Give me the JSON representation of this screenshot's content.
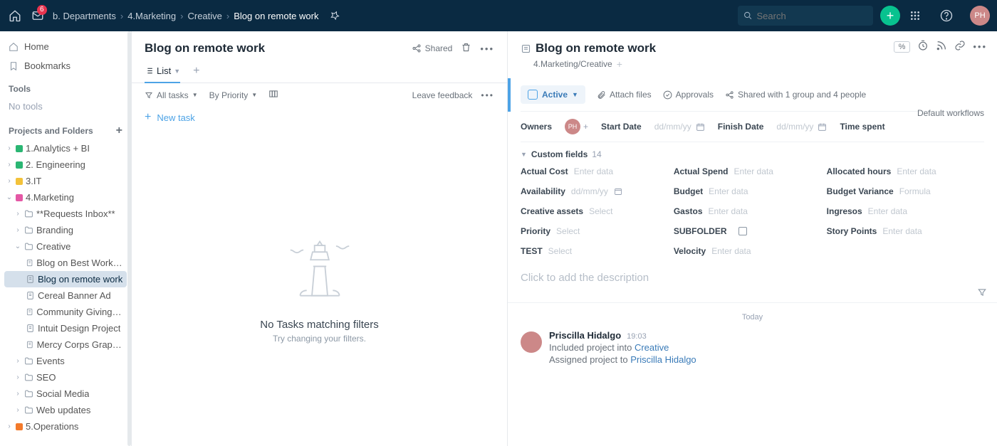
{
  "topbar": {
    "inbox_count": "6",
    "breadcrumbs": [
      "b. Departments",
      "4.Marketing",
      "Creative",
      "Blog on remote work"
    ],
    "search_placeholder": "Search"
  },
  "sidebar": {
    "home": "Home",
    "bookmarks": "Bookmarks",
    "tools_header": "Tools",
    "no_tools": "No tools",
    "projects_header": "Projects and Folders",
    "folders": [
      {
        "name": "1.Analytics + BI",
        "color": "#2bb673"
      },
      {
        "name": "2. Engineering",
        "color": "#2bb673"
      },
      {
        "name": "3.IT",
        "color": "#f3c23a"
      },
      {
        "name": "4.Marketing",
        "color": "#e458a5"
      },
      {
        "name": "5.Operations",
        "color": "#f37a2b"
      }
    ],
    "marketing_children": [
      "**Requests Inbox**",
      "Branding",
      "Creative",
      "Events",
      "SEO",
      "Social Media",
      "Web updates"
    ],
    "creative_children": [
      "Blog on Best Workplac...",
      "Blog on remote work",
      "Cereal Banner Ad",
      "Community Giving Cre...",
      "Intuit Design Project",
      "Mercy Corps Graphic ..."
    ]
  },
  "center": {
    "title": "Blog on remote work",
    "shared_label": "Shared",
    "list_tab": "List",
    "all_tasks": "All tasks",
    "by_priority": "By Priority",
    "leave_feedback": "Leave feedback",
    "new_task": "New task",
    "empty_title": "No Tasks matching filters",
    "empty_sub": "Try changing your filters."
  },
  "detail": {
    "title": "Blog on remote work",
    "location": "4.Marketing/Creative",
    "status_label": "Active",
    "attach_label": "Attach files",
    "approvals_label": "Approvals",
    "shared_text": "Shared with 1 group and 4 people",
    "default_workflows": "Default workflows",
    "owners_label": "Owners",
    "start_label": "Start Date",
    "finish_label": "Finish Date",
    "date_ph": "dd/mm/yy",
    "timespent_label": "Time spent",
    "custom_header": "Custom fields",
    "custom_count": "14",
    "fields": [
      {
        "name": "Actual Cost",
        "ph": "Enter data"
      },
      {
        "name": "Actual Spend",
        "ph": "Enter data"
      },
      {
        "name": "Allocated hours",
        "ph": "Enter data"
      },
      {
        "name": "Availability",
        "ph": "dd/mm/yy",
        "date": true
      },
      {
        "name": "Budget",
        "ph": "Enter data"
      },
      {
        "name": "Budget Variance",
        "ph": "Formula"
      },
      {
        "name": "Creative assets",
        "ph": "Select"
      },
      {
        "name": "Gastos",
        "ph": "Enter data"
      },
      {
        "name": "Ingresos",
        "ph": "Enter data"
      },
      {
        "name": "Priority",
        "ph": "Select"
      },
      {
        "name": "SUBFOLDER",
        "ph": "",
        "check": true
      },
      {
        "name": "Story Points",
        "ph": "Enter data"
      },
      {
        "name": "TEST",
        "ph": "Select"
      },
      {
        "name": "Velocity",
        "ph": "Enter data"
      }
    ],
    "desc_placeholder": "Click to add the description",
    "today_label": "Today",
    "activity": {
      "name": "Priscilla Hidalgo",
      "time": "19:03",
      "line1a": "Included project into ",
      "line1b": "Creative",
      "line2a": "Assigned project to ",
      "line2b": "Priscilla Hidalgo"
    }
  }
}
